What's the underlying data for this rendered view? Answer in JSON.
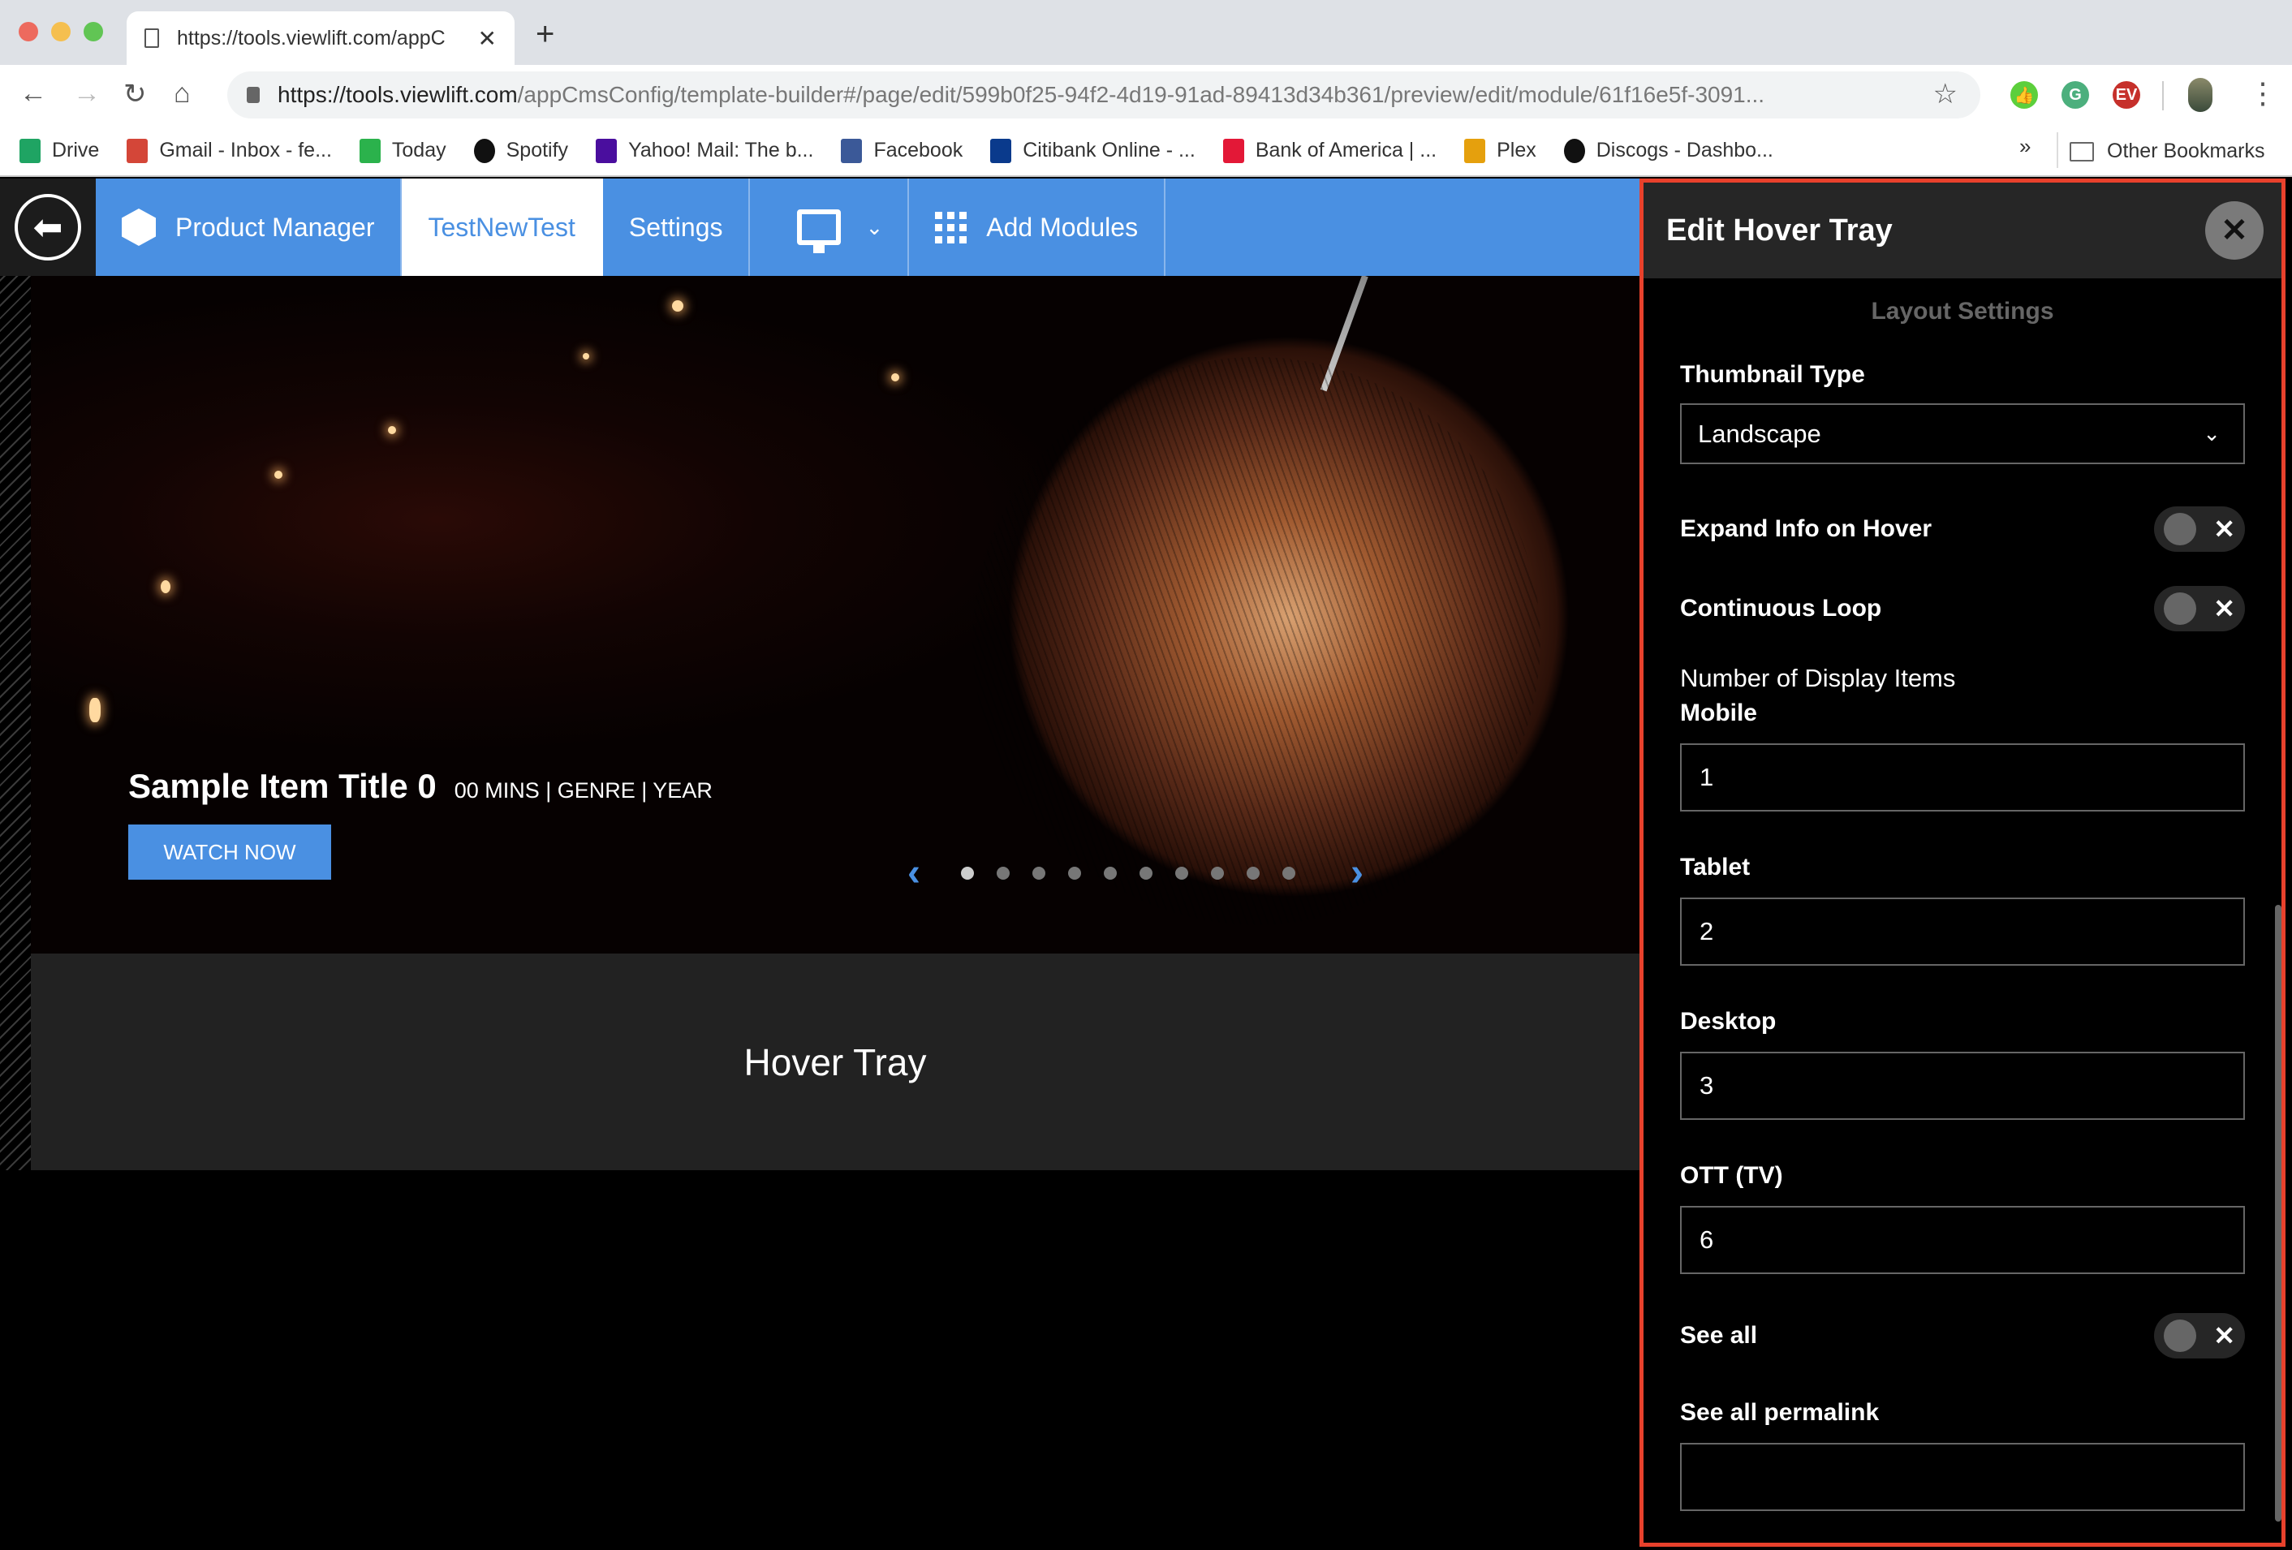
{
  "browser": {
    "tab_title": "https://tools.viewlift.com/appC",
    "url_host": "https://tools.viewlift.com",
    "url_path": "/appCmsConfig/template-builder#/page/edit/599b0f25-94f2-4d19-91ad-89413d34b361/preview/edit/module/61f16e5f-3091...",
    "bookmarks": [
      {
        "label": "Drive",
        "icon": "drive-icon",
        "color": "#1fa463"
      },
      {
        "label": "Gmail - Inbox - fe...",
        "icon": "gmail-icon",
        "color": "#d44638"
      },
      {
        "label": "Today",
        "icon": "feedly-icon",
        "color": "#2bb24c"
      },
      {
        "label": "Spotify",
        "icon": "spotify-icon",
        "color": "#111111"
      },
      {
        "label": "Yahoo! Mail: The b...",
        "icon": "yahoo-icon",
        "color": "#4a0e9e"
      },
      {
        "label": "Facebook",
        "icon": "facebook-icon",
        "color": "#3b5998"
      },
      {
        "label": "Citibank Online - ...",
        "icon": "citi-icon",
        "color": "#0a3a8c"
      },
      {
        "label": "Bank of America | ...",
        "icon": "bofa-icon",
        "color": "#e31837"
      },
      {
        "label": "Plex",
        "icon": "plex-icon",
        "color": "#e5a00d"
      },
      {
        "label": "Discogs - Dashbo...",
        "icon": "discogs-icon",
        "color": "#111111"
      }
    ],
    "more_bookmarks": "»",
    "other_bookmarks": "Other Bookmarks"
  },
  "app_header": {
    "back_icon": "back-arrow-icon",
    "items": [
      {
        "label": "Product Manager",
        "icon": "cube-icon"
      },
      {
        "label": "TestNewTest",
        "active": true
      },
      {
        "label": "Settings"
      },
      {
        "icon": "desktop-icon",
        "dropdown": true
      },
      {
        "label": "Add Modules",
        "icon": "grid-icon"
      }
    ]
  },
  "hero": {
    "title": "Sample Item Title 0",
    "meta": "00 MINS | GENRE | YEAR",
    "cta": "WATCH NOW",
    "slide_count": 10,
    "active_slide": 0
  },
  "hover_tray": {
    "label": "Hover Tray"
  },
  "panel": {
    "title": "Edit Hover Tray",
    "section": "Layout Settings",
    "thumbnail_type": {
      "label": "Thumbnail Type",
      "value": "Landscape"
    },
    "expand_info": {
      "label": "Expand Info on Hover",
      "on": false
    },
    "continuous_loop": {
      "label": "Continuous Loop",
      "on": false
    },
    "display_items": {
      "heading": "Number of Display Items",
      "mobile": {
        "label": "Mobile",
        "value": "1"
      },
      "tablet": {
        "label": "Tablet",
        "value": "2"
      },
      "desktop": {
        "label": "Desktop",
        "value": "3"
      },
      "ott": {
        "label": "OTT (TV)",
        "value": "6"
      }
    },
    "see_all": {
      "label": "See all",
      "on": false
    },
    "see_all_permalink": {
      "label": "See all permalink",
      "value": ""
    },
    "toggle_off_glyph": "✕",
    "close_glyph": "✕"
  },
  "colors": {
    "accent": "#4a90e2",
    "panel_border": "#e8412c"
  }
}
